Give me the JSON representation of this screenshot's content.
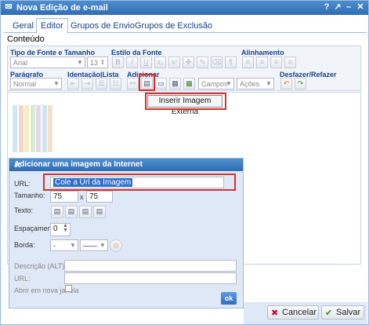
{
  "window": {
    "title": "Nova Edição de e-mail",
    "help_icon": "?",
    "close_icon": "✕"
  },
  "tabs": [
    {
      "label": "Geral"
    },
    {
      "label": "Editor"
    },
    {
      "label": "Grupos de Envio"
    },
    {
      "label": "Grupos de Exclusão"
    }
  ],
  "editor": {
    "content_label": "Conteúdo",
    "groups": {
      "font": "Tipo de Fonte e Tamanho",
      "style": "Estilo da Fonte",
      "align": "Alinhamento",
      "paragraph": "Parágrafo",
      "indent": "Identação|Lista",
      "add": "Adicionar",
      "undo": "Desfazer/Refazer"
    },
    "font_family": "Arial",
    "font_size": "13",
    "paragraph": "Normal",
    "fields_combo": "Campos",
    "actions_combo": "Ações",
    "tooltip": "Inserir Imagem Externa"
  },
  "stripe_colors": [
    "#cfe7f3",
    "#f5d7c9",
    "#f7ecc5",
    "#d7ebd3",
    "#e5d7ee",
    "#cfe4f0",
    "#f3e2c9"
  ],
  "dialog": {
    "title": "Adicionar uma imagem da Internet",
    "url_label": "URL:",
    "url_value": "Cole a Url da Imagem",
    "size_label": "Tamanho:",
    "width": "75",
    "height": "75",
    "size_sep": "x",
    "text_label": "Texto:",
    "spacing_label": "Espaçamento:",
    "spacing_value": "0",
    "border_label": "Borda:",
    "border_value": "-",
    "alt_label": "Descrição (ALT):",
    "url2_label": "URL:",
    "new_window_label": "Abrir em nova janela",
    "ok_label": "ok"
  },
  "buttons": {
    "cancel": "Cancelar",
    "save": "Salvar"
  }
}
